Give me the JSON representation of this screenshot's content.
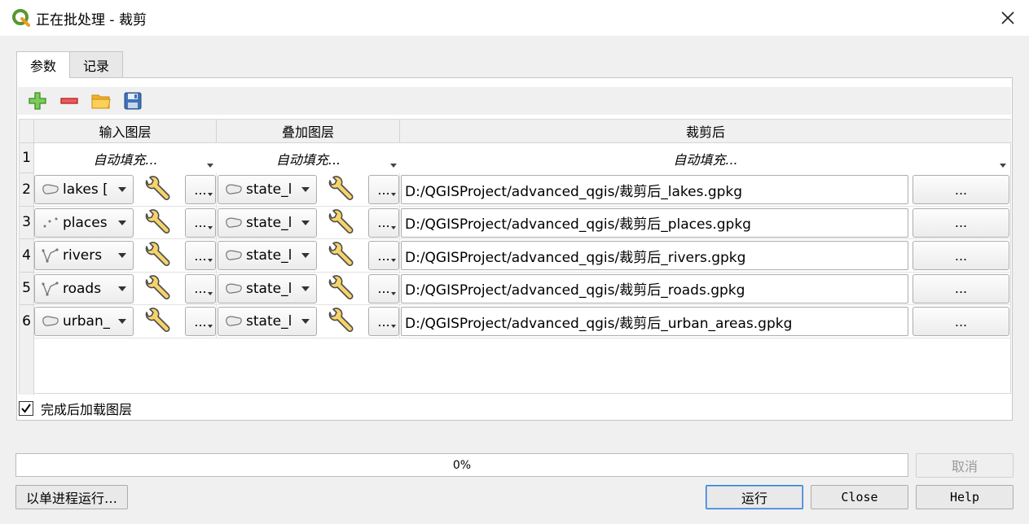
{
  "window": {
    "title": "正在批处理 - 裁剪"
  },
  "tabs": [
    {
      "label": "参数"
    },
    {
      "label": "记录"
    }
  ],
  "toolbar": {
    "add_icon": "add-row-icon",
    "remove_icon": "remove-row-icon",
    "open_icon": "folder-open-icon",
    "save_icon": "save-icon"
  },
  "columns": {
    "input": "输入图层",
    "overlay": "叠加图层",
    "output": "裁剪后"
  },
  "autofill": {
    "input": "自动填充...",
    "overlay": "自动填充...",
    "output": "自动填充..."
  },
  "rows": [
    {
      "num": "2",
      "input": "lakes [",
      "input_geom": "polygon",
      "overlay": "state_l",
      "output": "D:/QGISProject/advanced_qgis/裁剪后_lakes.gpkg"
    },
    {
      "num": "3",
      "input": "places",
      "input_geom": "point",
      "overlay": "state_l",
      "output": "D:/QGISProject/advanced_qgis/裁剪后_places.gpkg"
    },
    {
      "num": "4",
      "input": "rivers",
      "input_geom": "line",
      "overlay": "state_l",
      "output": "D:/QGISProject/advanced_qgis/裁剪后_rivers.gpkg"
    },
    {
      "num": "5",
      "input": "roads",
      "input_geom": "line",
      "overlay": "state_l",
      "output": "D:/QGISProject/advanced_qgis/裁剪后_roads.gpkg"
    },
    {
      "num": "6",
      "input": "urban_",
      "input_geom": "polygon",
      "overlay": "state_l",
      "output": "D:/QGISProject/advanced_qgis/裁剪后_urban_areas.gpkg"
    }
  ],
  "autofill_row_num": "1",
  "dots_label": "...",
  "browse_label": "...",
  "load_layers": {
    "label": "完成后加载图层",
    "checked": true
  },
  "progress": {
    "value": 0,
    "text": "0%"
  },
  "buttons": {
    "cancel": "取消",
    "run_single": "以单进程运行…",
    "run": "运行",
    "close": "Close",
    "help": "Help"
  }
}
